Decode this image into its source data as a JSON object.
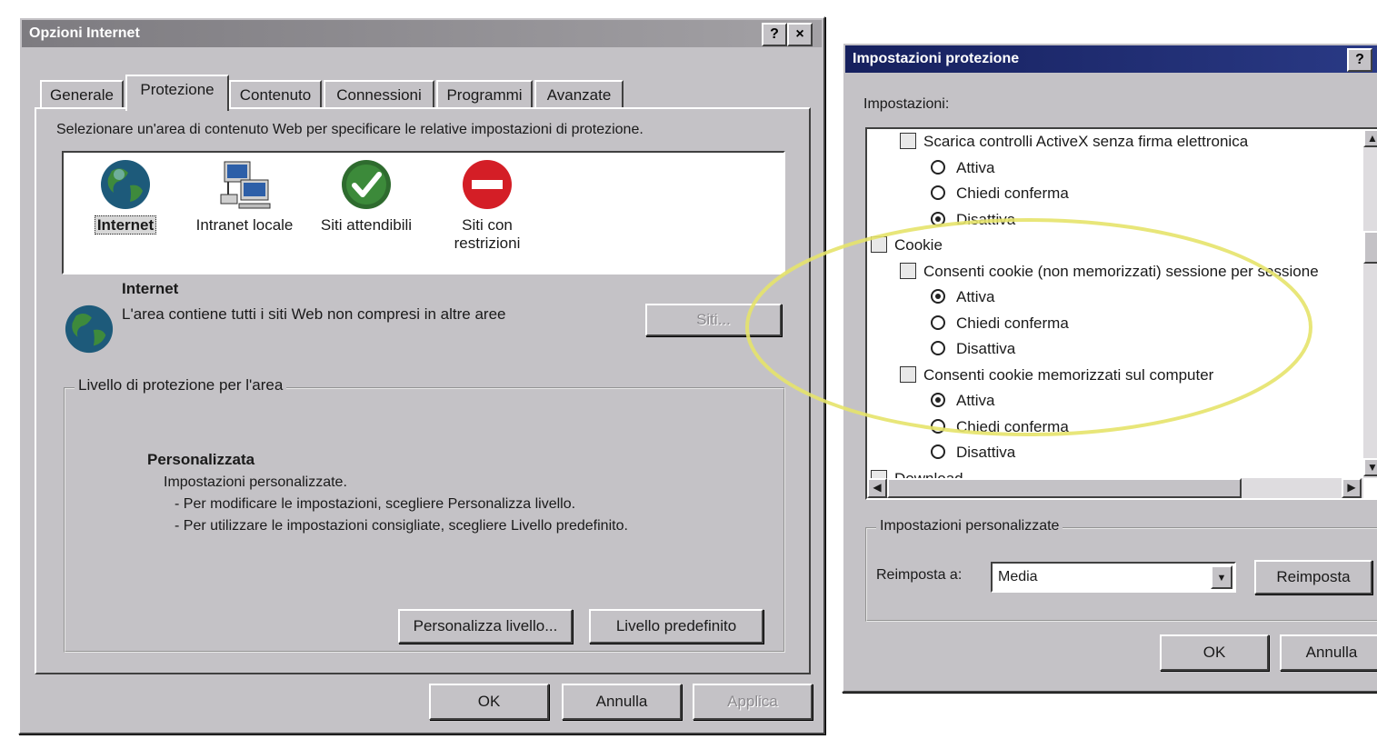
{
  "internet_options": {
    "title": "Opzioni Internet",
    "help_btn": "?",
    "close_btn": "×",
    "tabs": [
      "Generale",
      "Protezione",
      "Contenuto",
      "Connessioni",
      "Programmi",
      "Avanzate"
    ],
    "active_tab": "Protezione",
    "instruction": "Selezionare un'area di contenuto Web per specificare le relative impostazioni di protezione.",
    "zones": [
      {
        "label": "Internet",
        "icon": "globe-icon"
      },
      {
        "label": "Intranet locale",
        "icon": "network-computers-icon"
      },
      {
        "label": "Siti attendibili",
        "icon": "checkmark-icon"
      },
      {
        "label": "Siti con restrizioni",
        "icon": "no-entry-icon"
      }
    ],
    "zone_title": "Internet",
    "zone_description": "L'area contiene tutti i siti Web non compresi in altre aree",
    "sites_button": "Siti...",
    "level_group_label": "Livello di protezione per l'area",
    "level_name": "Personalizzata",
    "level_lines": [
      "Impostazioni personalizzate.",
      "- Per modificare le impostazioni, scegliere Personalizza livello.",
      "- Per utilizzare le impostazioni consigliate, scegliere Livello predefinito."
    ],
    "customize_button": "Personalizza livello...",
    "default_button": "Livello predefinito",
    "ok_button": "OK",
    "cancel_button": "Annulla",
    "apply_button": "Applica"
  },
  "security_settings": {
    "title": "Impostazioni protezione",
    "help_btn": "?",
    "settings_label": "Impostazioni:",
    "tree": [
      {
        "type": "item",
        "text": "Scarica controlli ActiveX senza firma elettronica"
      },
      {
        "type": "option",
        "text": "Attiva",
        "selected": false
      },
      {
        "type": "option",
        "text": "Chiedi conferma",
        "selected": false
      },
      {
        "type": "option",
        "text": "Disattiva",
        "selected": true
      },
      {
        "type": "category",
        "text": "Cookie"
      },
      {
        "type": "item",
        "text": "Consenti cookie (non memorizzati) sessione per sessione"
      },
      {
        "type": "option",
        "text": "Attiva",
        "selected": true
      },
      {
        "type": "option",
        "text": "Chiedi conferma",
        "selected": false
      },
      {
        "type": "option",
        "text": "Disattiva",
        "selected": false
      },
      {
        "type": "item",
        "text": "Consenti cookie memorizzati sul computer"
      },
      {
        "type": "option",
        "text": "Attiva",
        "selected": true
      },
      {
        "type": "option",
        "text": "Chiedi conferma",
        "selected": false
      },
      {
        "type": "option",
        "text": "Disattiva",
        "selected": false
      },
      {
        "type": "category",
        "text": "Download"
      }
    ],
    "custom_group_label": "Impostazioni personalizzate",
    "reset_label": "Reimposta a:",
    "reset_value": "Media",
    "reset_button": "Reimposta",
    "ok_button": "OK",
    "cancel_button": "Annulla"
  },
  "colors": {
    "dialog_face": "#c4c2c6",
    "titlebar_active": "#1c2a6e",
    "titlebar_inactive": "#8e8c90",
    "highlight_circle": "#e6e36a"
  }
}
